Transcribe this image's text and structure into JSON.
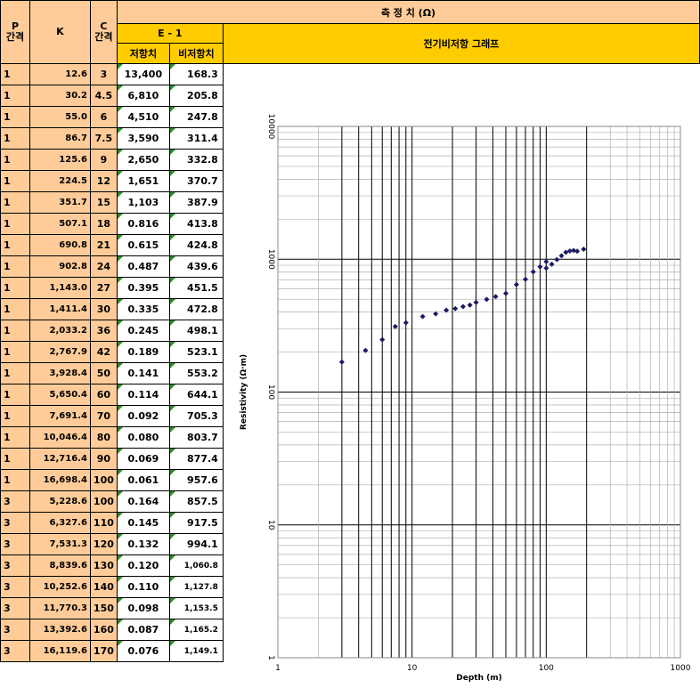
{
  "header": {
    "measure_title": "측 정 치 (Ω)",
    "p_label": "P\n간격",
    "k_label": "K",
    "c_label": "C\n간격",
    "e_label": "E - 1",
    "resist_label": "저항치",
    "app_resist_label": "비저항치",
    "graph_title": "전기비저항 그래프"
  },
  "rows": [
    {
      "p": "1",
      "k": "12.6",
      "c": "3",
      "r": "13,400",
      "a": "168.3"
    },
    {
      "p": "1",
      "k": "30.2",
      "c": "4.5",
      "r": "6,810",
      "a": "205.8"
    },
    {
      "p": "1",
      "k": "55.0",
      "c": "6",
      "r": "4,510",
      "a": "247.8"
    },
    {
      "p": "1",
      "k": "86.7",
      "c": "7.5",
      "r": "3,590",
      "a": "311.4"
    },
    {
      "p": "1",
      "k": "125.6",
      "c": "9",
      "r": "2,650",
      "a": "332.8"
    },
    {
      "p": "1",
      "k": "224.5",
      "c": "12",
      "r": "1,651",
      "a": "370.7"
    },
    {
      "p": "1",
      "k": "351.7",
      "c": "15",
      "r": "1,103",
      "a": "387.9"
    },
    {
      "p": "1",
      "k": "507.1",
      "c": "18",
      "r": "0.816",
      "a": "413.8"
    },
    {
      "p": "1",
      "k": "690.8",
      "c": "21",
      "r": "0.615",
      "a": "424.8"
    },
    {
      "p": "1",
      "k": "902.8",
      "c": "24",
      "r": "0.487",
      "a": "439.6"
    },
    {
      "p": "1",
      "k": "1,143.0",
      "c": "27",
      "r": "0.395",
      "a": "451.5"
    },
    {
      "p": "1",
      "k": "1,411.4",
      "c": "30",
      "r": "0.335",
      "a": "472.8"
    },
    {
      "p": "1",
      "k": "2,033.2",
      "c": "36",
      "r": "0.245",
      "a": "498.1"
    },
    {
      "p": "1",
      "k": "2,767.9",
      "c": "42",
      "r": "0.189",
      "a": "523.1"
    },
    {
      "p": "1",
      "k": "3,928.4",
      "c": "50",
      "r": "0.141",
      "a": "553.2"
    },
    {
      "p": "1",
      "k": "5,650.4",
      "c": "60",
      "r": "0.114",
      "a": "644.1"
    },
    {
      "p": "1",
      "k": "7,691.4",
      "c": "70",
      "r": "0.092",
      "a": "705.3"
    },
    {
      "p": "1",
      "k": "10,046.4",
      "c": "80",
      "r": "0.080",
      "a": "803.7"
    },
    {
      "p": "1",
      "k": "12,716.4",
      "c": "90",
      "r": "0.069",
      "a": "877.4"
    },
    {
      "p": "1",
      "k": "16,698.4",
      "c": "100",
      "r": "0.061",
      "a": "957.6"
    },
    {
      "p": "3",
      "k": "5,228.6",
      "c": "100",
      "r": "0.164",
      "a": "857.5"
    },
    {
      "p": "3",
      "k": "6,327.6",
      "c": "110",
      "r": "0.145",
      "a": "917.5"
    },
    {
      "p": "3",
      "k": "7,531.3",
      "c": "120",
      "r": "0.132",
      "a": "994.1"
    },
    {
      "p": "3",
      "k": "8,839.6",
      "c": "130",
      "r": "0.120",
      "a": "1,060.8"
    },
    {
      "p": "3",
      "k": "10,252.6",
      "c": "140",
      "r": "0.110",
      "a": "1,127.8"
    },
    {
      "p": "3",
      "k": "11,770.3",
      "c": "150",
      "r": "0.098",
      "a": "1,153.5"
    },
    {
      "p": "3",
      "k": "13,392.6",
      "c": "160",
      "r": "0.087",
      "a": "1,165.2"
    },
    {
      "p": "3",
      "k": "16,119.6",
      "c": "170",
      "r": "0.076",
      "a": "1,149.1"
    }
  ],
  "chart_data": {
    "type": "scatter",
    "xscale": "log",
    "yscale": "log",
    "xlim": [
      1,
      1000
    ],
    "ylim": [
      1,
      10000
    ],
    "xlabel": "Depth (m)",
    "ylabel": "Resistivity (Ω·m)",
    "xticks": [
      "1",
      "10",
      "100",
      "1000"
    ],
    "yticks": [
      "1",
      "10",
      "100",
      "1000",
      "10000"
    ],
    "grid": true,
    "marker_color": "#1a1a66",
    "x": [
      3,
      4.5,
      6,
      7.5,
      9,
      12,
      15,
      18,
      21,
      24,
      27,
      30,
      36,
      42,
      50,
      60,
      70,
      80,
      90,
      100,
      100,
      110,
      120,
      130,
      140,
      150,
      160,
      170,
      190
    ],
    "y": [
      168.3,
      205.8,
      247.8,
      311.4,
      332.8,
      370.7,
      387.9,
      413.8,
      424.8,
      439.6,
      451.5,
      472.8,
      498.1,
      523.1,
      553.2,
      644.1,
      705.3,
      803.7,
      877.4,
      957.6,
      857.5,
      917.5,
      994.1,
      1060.8,
      1127.8,
      1153.5,
      1165.2,
      1149.1,
      1190
    ]
  }
}
